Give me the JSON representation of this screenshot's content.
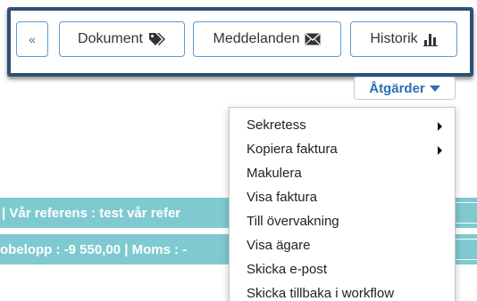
{
  "toolbar": {
    "collapse_label": "«",
    "buttons": [
      {
        "label": "Dokument",
        "icon": "tags-icon"
      },
      {
        "label": "Meddelanden",
        "icon": "envelope-icon"
      },
      {
        "label": "Historik",
        "icon": "bar-chart-icon"
      }
    ]
  },
  "actions": {
    "label": "Åtgärder",
    "menu": [
      {
        "label": "Sekretess",
        "submenu": true
      },
      {
        "label": "Kopiera faktura",
        "submenu": true
      },
      {
        "label": "Makulera",
        "submenu": false
      },
      {
        "label": "Visa faktura",
        "submenu": false
      },
      {
        "label": "Till övervakning",
        "submenu": false
      },
      {
        "label": "Visa ägare",
        "submenu": false
      },
      {
        "label": "Skicka e-post",
        "submenu": false
      },
      {
        "label": "Skicka tillbaka i workflow",
        "submenu": false
      }
    ]
  },
  "info": {
    "line1": "| Vår referens :  test vår refer",
    "line2": "obelopp : -9 550,00 | Moms : -"
  },
  "colors": {
    "panel_border": "#2f4f76",
    "button_border": "#5b9bd5",
    "accent_text": "#2d6fb5",
    "info_bar": "#7fcad0"
  }
}
